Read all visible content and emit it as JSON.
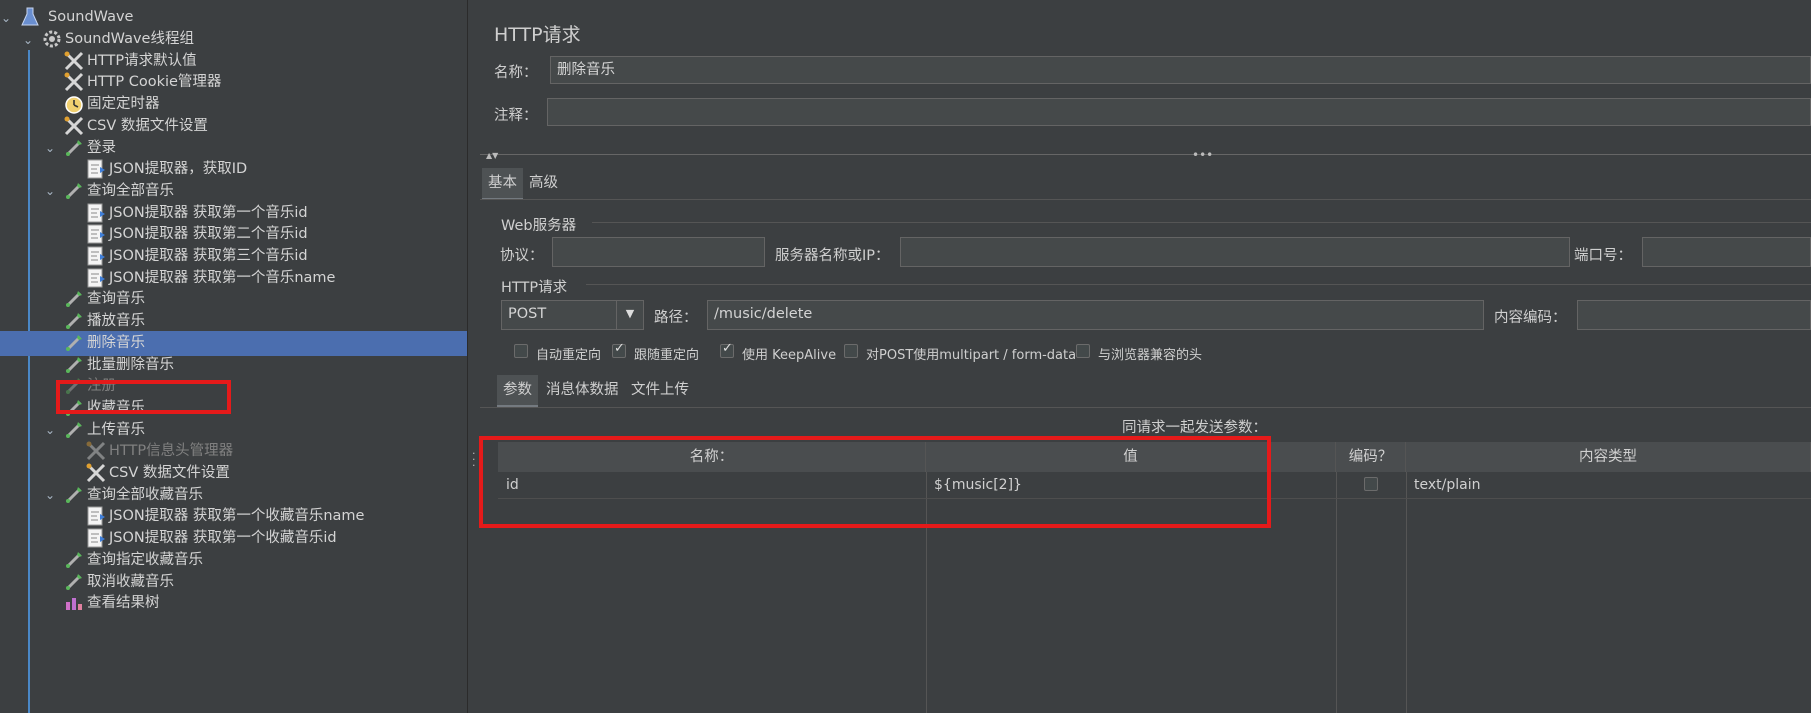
{
  "tree": {
    "root": "SoundWave",
    "nodes": [
      {
        "label": "SoundWave线程组",
        "icon": "gear-icon"
      },
      {
        "label": "HTTP请求默认值",
        "icon": "wrench-icon"
      },
      {
        "label": "HTTP Cookie管理器",
        "icon": "wrench-icon"
      },
      {
        "label": "固定定时器",
        "icon": "timer-icon"
      },
      {
        "label": "CSV 数据文件设置",
        "icon": "wrench-icon"
      },
      {
        "label": "登录",
        "icon": "sampler-icon"
      },
      {
        "label": "JSON提取器，获取ID",
        "icon": "extractor-icon"
      },
      {
        "label": "查询全部音乐",
        "icon": "sampler-icon"
      },
      {
        "label": "JSON提取器 获取第一个音乐id",
        "icon": "extractor-icon"
      },
      {
        "label": "JSON提取器 获取第二个音乐id",
        "icon": "extractor-icon"
      },
      {
        "label": "JSON提取器 获取第三个音乐id",
        "icon": "extractor-icon"
      },
      {
        "label": "JSON提取器 获取第一个音乐name",
        "icon": "extractor-icon"
      },
      {
        "label": "查询音乐",
        "icon": "sampler-icon"
      },
      {
        "label": "播放音乐",
        "icon": "sampler-icon"
      },
      {
        "label": "删除音乐",
        "icon": "sampler-icon"
      },
      {
        "label": "批量删除音乐",
        "icon": "sampler-icon"
      },
      {
        "label": "注册",
        "icon": "sampler-icon"
      },
      {
        "label": "收藏音乐",
        "icon": "sampler-icon"
      },
      {
        "label": "上传音乐",
        "icon": "sampler-icon"
      },
      {
        "label": "HTTP信息头管理器",
        "icon": "wrench-icon"
      },
      {
        "label": "CSV 数据文件设置",
        "icon": "wrench-icon"
      },
      {
        "label": "查询全部收藏音乐",
        "icon": "sampler-icon"
      },
      {
        "label": "JSON提取器 获取第一个收藏音乐name",
        "icon": "extractor-icon"
      },
      {
        "label": "JSON提取器 获取第一个收藏音乐id",
        "icon": "extractor-icon"
      },
      {
        "label": "查询指定收藏音乐",
        "icon": "sampler-icon"
      },
      {
        "label": "取消收藏音乐",
        "icon": "sampler-icon"
      },
      {
        "label": "查看结果树",
        "icon": "listener-icon"
      }
    ]
  },
  "panel": {
    "title": "HTTP请求",
    "name_label": "名称：",
    "name_value": "删除音乐",
    "comment_label": "注释：",
    "comment_value": "",
    "tabs": [
      "基本",
      "高级"
    ],
    "web_server_title": "Web服务器",
    "protocol_label": "协议：",
    "protocol_value": "",
    "server_label": "服务器名称或IP：",
    "server_value": "",
    "port_label": "端口号：",
    "port_value": "",
    "http_request_title": "HTTP请求",
    "method": "POST",
    "path_label": "路径：",
    "path_value": "/music/delete",
    "encoding_label": "内容编码：",
    "encoding_value": "",
    "options": [
      {
        "label": "自动重定向",
        "checked": false
      },
      {
        "label": "跟随重定向",
        "checked": true
      },
      {
        "label": "使用 KeepAlive",
        "checked": true
      },
      {
        "label": "对POST使用multipart / form-data",
        "checked": false
      },
      {
        "label": "与浏览器兼容的头",
        "checked": false
      }
    ],
    "sub_tabs": [
      "参数",
      "消息体数据",
      "文件上传"
    ],
    "params_caption": "同请求一起发送参数：",
    "columns": [
      "名称：",
      "值",
      "编码？",
      "内容类型"
    ],
    "rows": [
      {
        "name": "id",
        "value": "${music[2]}",
        "encode": false,
        "content_type": "text/plain"
      }
    ]
  },
  "colors": {
    "background": "#3c3f41",
    "selection": "#4b6eaf",
    "tree_line": "#4a88c7",
    "highlight_box": "#e51a1a"
  }
}
